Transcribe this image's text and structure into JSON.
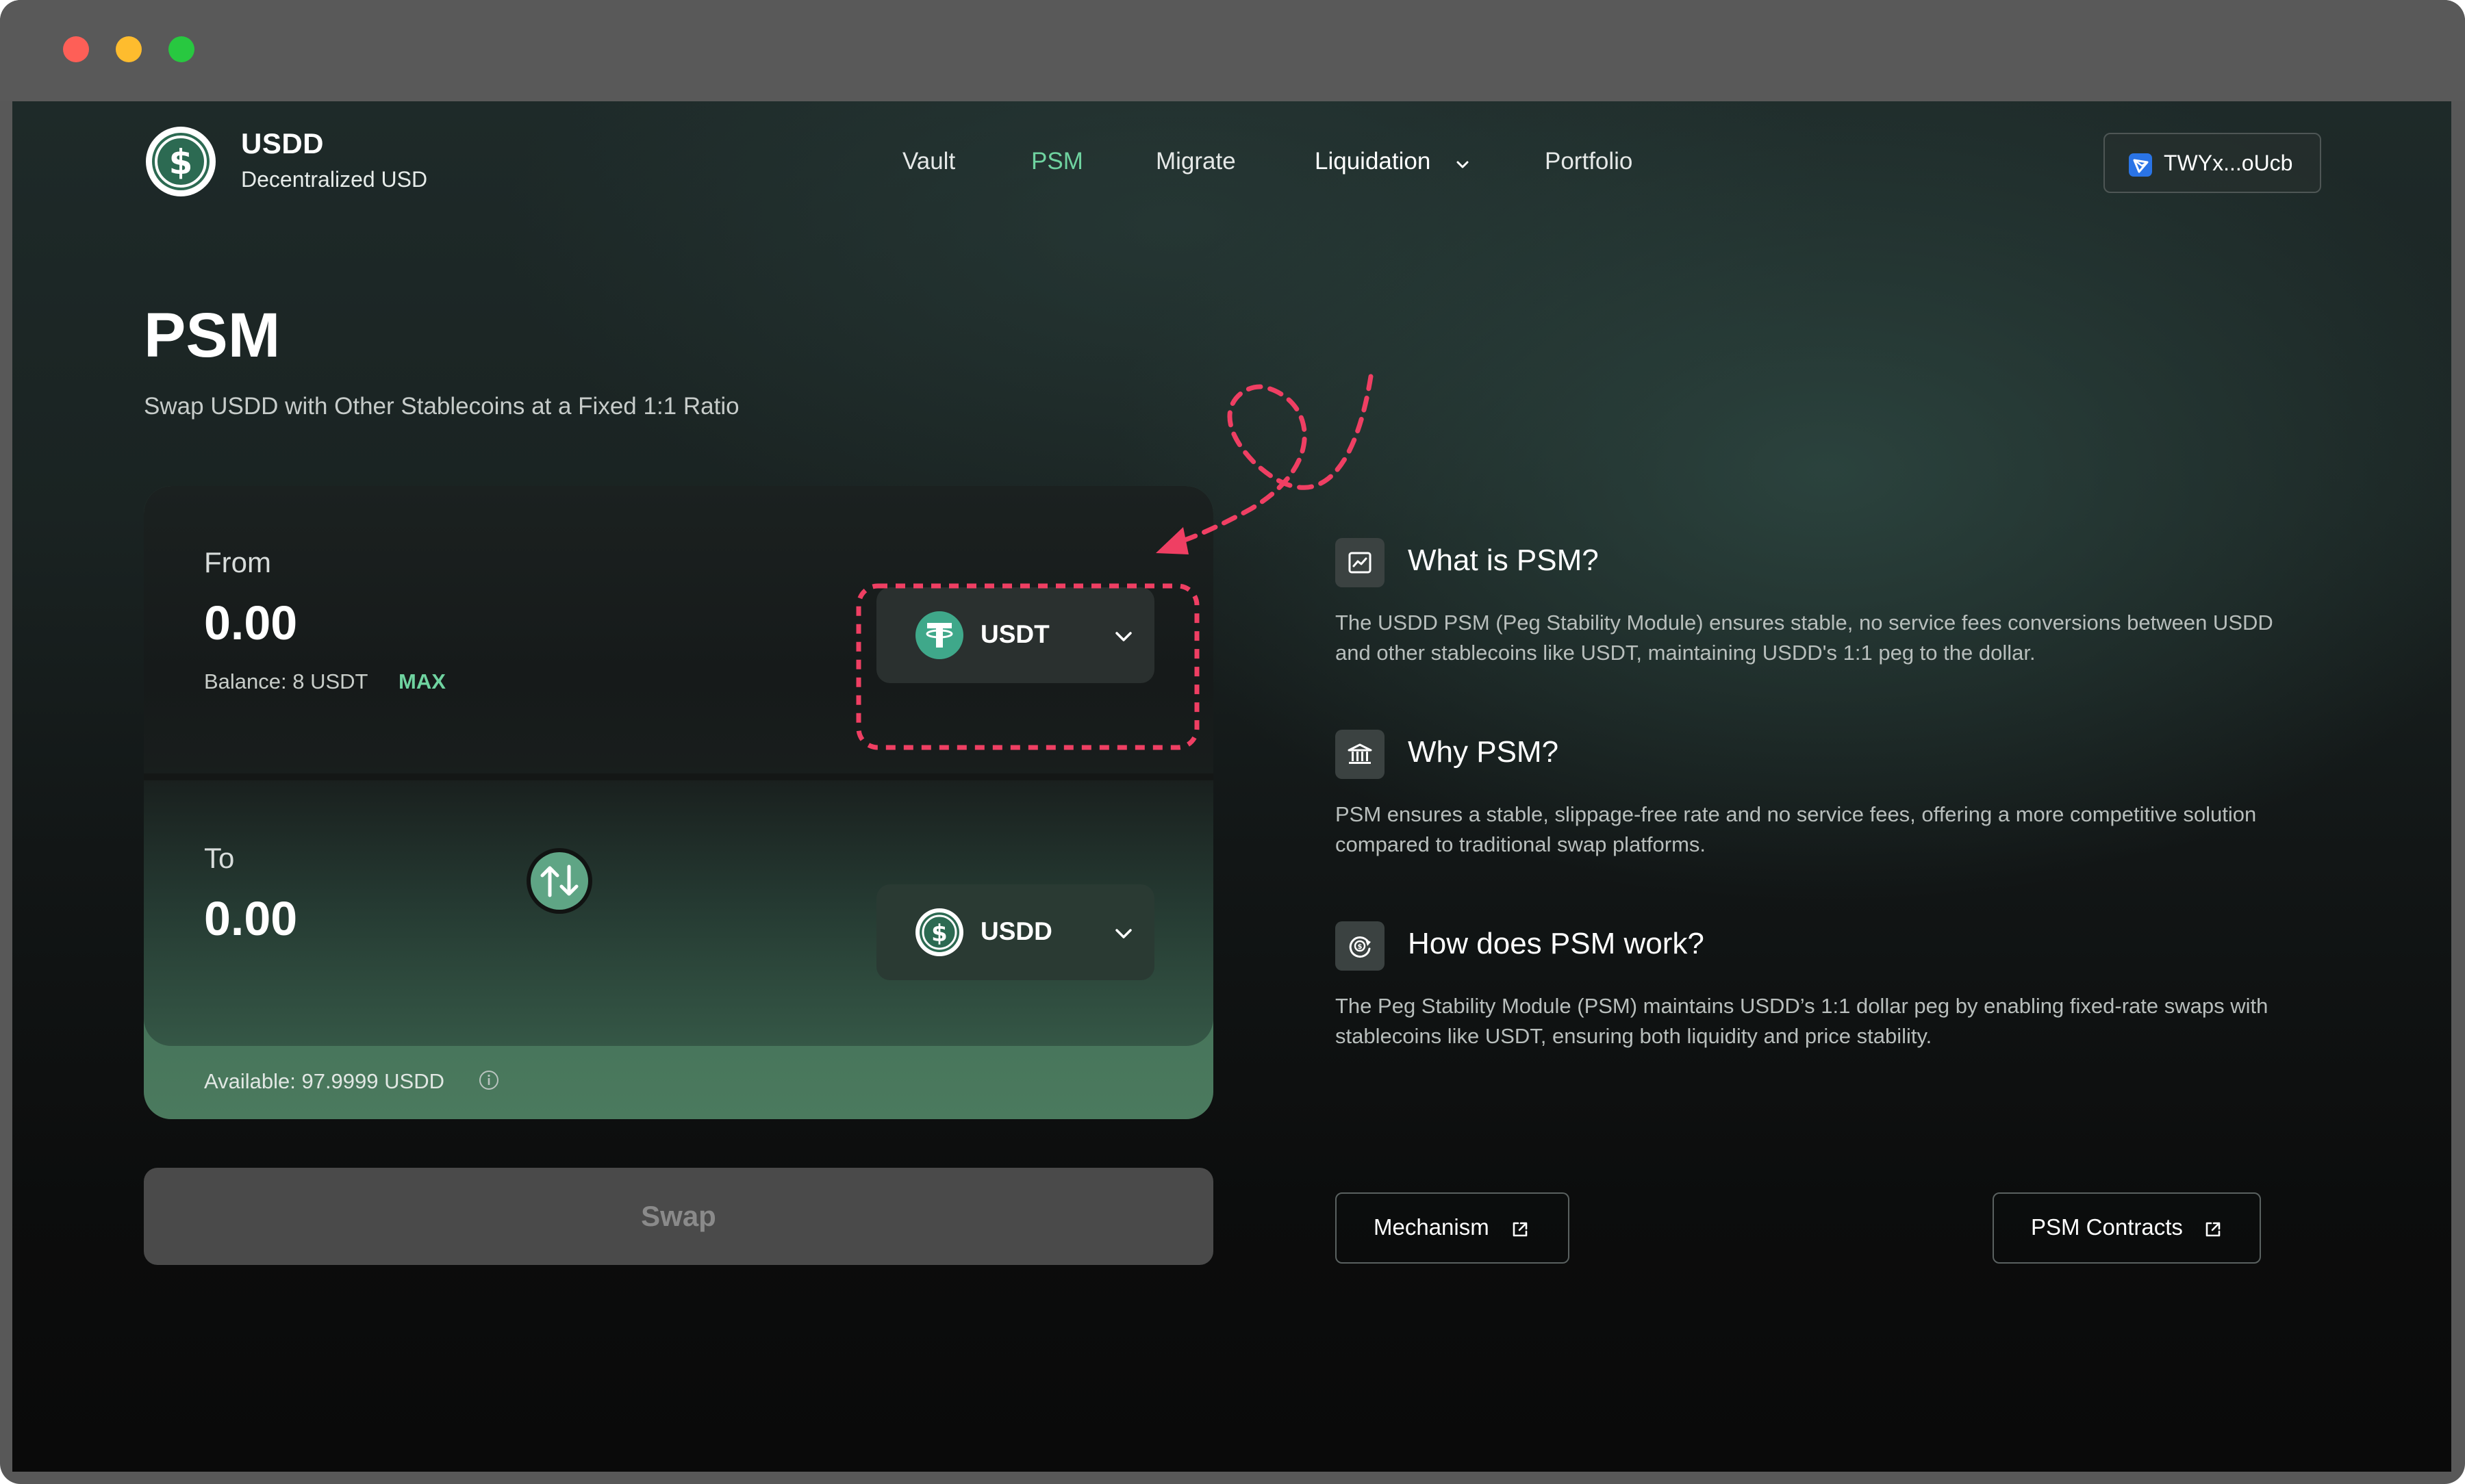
{
  "brand": {
    "name": "USDD",
    "tagline": "Decentralized USD"
  },
  "nav": {
    "items": [
      {
        "label": "Vault"
      },
      {
        "label": "PSM"
      },
      {
        "label": "Migrate"
      },
      {
        "label": "Liquidation"
      },
      {
        "label": "Portfolio"
      }
    ],
    "active": "PSM"
  },
  "wallet": {
    "address": "TWYx...oUcb"
  },
  "page": {
    "title": "PSM",
    "subtitle": "Swap USDD with Other Stablecoins at a Fixed 1:1 Ratio"
  },
  "swap": {
    "from_label": "From",
    "from_amount": "0.00",
    "balance_label": "Balance: 8 USDT",
    "max_label": "MAX",
    "from_token": "USDT",
    "to_label": "To",
    "to_amount": "0.00",
    "to_token": "USDD",
    "available": "Available: 97.9999 USDD",
    "button_label": "Swap"
  },
  "faq": [
    {
      "title": "What is PSM?",
      "body": "The USDD PSM (Peg Stability Module) ensures stable, no service fees conversions between USDD and other stablecoins like USDT, maintaining USDD's 1:1 peg to the dollar.",
      "icon": "chart-box-icon"
    },
    {
      "title": "Why PSM?",
      "body": "PSM ensures a stable, slippage-free rate and no service fees, offering a more competitive solution compared to traditional swap platforms.",
      "icon": "bank-icon"
    },
    {
      "title": "How does PSM work?",
      "body": "The Peg Stability Module (PSM) maintains USDD’s 1:1 dollar peg by enabling fixed-rate swaps with stablecoins like USDT, ensuring both liquidity and price stability.",
      "icon": "coin-cycle-icon"
    }
  ],
  "links": {
    "mechanism": "Mechanism",
    "contracts": "PSM Contracts"
  },
  "colors": {
    "accent": "#6fd3a0",
    "annotation": "#ef3f63",
    "tether": "#3fa88a"
  }
}
